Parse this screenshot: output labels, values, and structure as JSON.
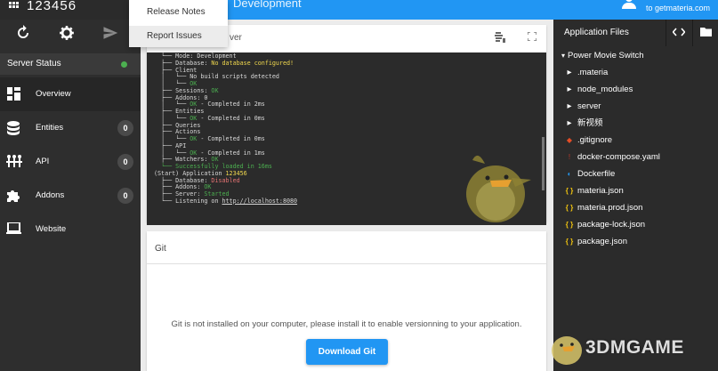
{
  "topbar": {
    "app_name": "123456",
    "environment_text": "Development",
    "user_subtext": "to getmateria.com"
  },
  "menu": {
    "items": [
      {
        "label": "Release Notes"
      },
      {
        "label": "Report Issues"
      }
    ]
  },
  "sidebar": {
    "server_status_label": "Server Status",
    "nav": [
      {
        "label": "Overview",
        "icon": "dashboard-icon",
        "badge": null
      },
      {
        "label": "Entities",
        "icon": "database-icon",
        "badge": "0"
      },
      {
        "label": "API",
        "icon": "api-icon",
        "badge": "0"
      },
      {
        "label": "Addons",
        "icon": "puzzle-icon",
        "badge": "0"
      },
      {
        "label": "Website",
        "icon": "laptop-icon",
        "badge": null
      }
    ]
  },
  "server_card": {
    "title_suffix": "ver",
    "console_lines": [
      [
        {
          "t": "  └── Mode: Development",
          "c": "#d8d8d8"
        }
      ],
      [
        {
          "t": "  ├── Database: ",
          "c": "#d8d8d8"
        },
        {
          "t": "No database configured!",
          "c": "#f2d94e"
        }
      ],
      [
        {
          "t": "  ├── Client",
          "c": "#d8d8d8"
        }
      ],
      [
        {
          "t": "  │   └── No build scripts detected",
          "c": "#d8d8d8"
        }
      ],
      [
        {
          "t": "  │   └── ",
          "c": "#d8d8d8"
        },
        {
          "t": "OK",
          "c": "#4caf50"
        }
      ],
      [
        {
          "t": "  ├── Sessions: ",
          "c": "#d8d8d8"
        },
        {
          "t": "OK",
          "c": "#4caf50"
        }
      ],
      [
        {
          "t": "  ├── Addons: 0",
          "c": "#d8d8d8"
        }
      ],
      [
        {
          "t": "  │   └── ",
          "c": "#d8d8d8"
        },
        {
          "t": "OK",
          "c": "#4caf50"
        },
        {
          "t": " - Completed in 2ms",
          "c": "#d8d8d8"
        }
      ],
      [
        {
          "t": "  ├── Entities",
          "c": "#d8d8d8"
        }
      ],
      [
        {
          "t": "  │   └── ",
          "c": "#d8d8d8"
        },
        {
          "t": "OK",
          "c": "#4caf50"
        },
        {
          "t": " - Completed in 0ms",
          "c": "#d8d8d8"
        }
      ],
      [
        {
          "t": "  ├── Queries",
          "c": "#d8d8d8"
        }
      ],
      [
        {
          "t": "  ├── Actions",
          "c": "#d8d8d8"
        }
      ],
      [
        {
          "t": "  │   └── ",
          "c": "#d8d8d8"
        },
        {
          "t": "OK",
          "c": "#4caf50"
        },
        {
          "t": " - Completed in 0ms",
          "c": "#d8d8d8"
        }
      ],
      [
        {
          "t": "  ├── API",
          "c": "#d8d8d8"
        }
      ],
      [
        {
          "t": "  │   └── ",
          "c": "#d8d8d8"
        },
        {
          "t": "OK",
          "c": "#4caf50"
        },
        {
          "t": " - Completed in 1ms",
          "c": "#d8d8d8"
        }
      ],
      [
        {
          "t": "  ├── Watchers: ",
          "c": "#d8d8d8"
        },
        {
          "t": "OK",
          "c": "#4caf50"
        }
      ],
      [
        {
          "t": "  └── Successfully loaded in 16ms",
          "c": "#4caf50"
        }
      ],
      [
        {
          "t": "(Start) Application ",
          "c": "#d8d8d8"
        },
        {
          "t": "123456",
          "c": "#f2d94e"
        }
      ],
      [
        {
          "t": "  ├── Database: ",
          "c": "#d8d8d8"
        },
        {
          "t": "Disabled",
          "c": "#e57373"
        }
      ],
      [
        {
          "t": "  ├── Addons: ",
          "c": "#d8d8d8"
        },
        {
          "t": "OK",
          "c": "#4caf50"
        }
      ],
      [
        {
          "t": "  ├── Server: ",
          "c": "#d8d8d8"
        },
        {
          "t": "Started",
          "c": "#4caf50"
        }
      ],
      [
        {
          "t": "  └── Listening on ",
          "c": "#d8d8d8"
        },
        {
          "t": "http://localhost:8080",
          "c": "#d8d8d8",
          "u": true
        }
      ]
    ]
  },
  "git_card": {
    "title": "Git",
    "message": "Git is not installed on your computer, please install it to enable versionning to your application.",
    "button_label": "Download Git"
  },
  "files_panel": {
    "title": "Application Files",
    "root": "Power Movie Switch",
    "items": [
      {
        "label": ".materia",
        "type": "folder",
        "icon": "▸",
        "color": "#ffffff"
      },
      {
        "label": "node_modules",
        "type": "folder",
        "icon": "▸",
        "color": "#ffffff"
      },
      {
        "label": "server",
        "type": "folder",
        "icon": "▸",
        "color": "#ffffff"
      },
      {
        "label": "新视频",
        "type": "folder",
        "icon": "▸",
        "color": "#ffffff"
      },
      {
        "label": ".gitignore",
        "type": "file",
        "icon": "◆",
        "color": "#e44d26"
      },
      {
        "label": "docker-compose.yaml",
        "type": "file",
        "icon": "!",
        "color": "#c0392b"
      },
      {
        "label": "Dockerfile",
        "type": "file",
        "icon": "◐",
        "color": "#2496ed"
      },
      {
        "label": "materia.json",
        "type": "file",
        "icon": "{ }",
        "color": "#f1c40f"
      },
      {
        "label": "materia.prod.json",
        "type": "file",
        "icon": "{ }",
        "color": "#f1c40f"
      },
      {
        "label": "package-lock.json",
        "type": "file",
        "icon": "{ }",
        "color": "#f1c40f"
      },
      {
        "label": "package.json",
        "type": "file",
        "icon": "{ }",
        "color": "#f1c40f"
      }
    ]
  },
  "watermark": {
    "text": "3DMGAME"
  }
}
